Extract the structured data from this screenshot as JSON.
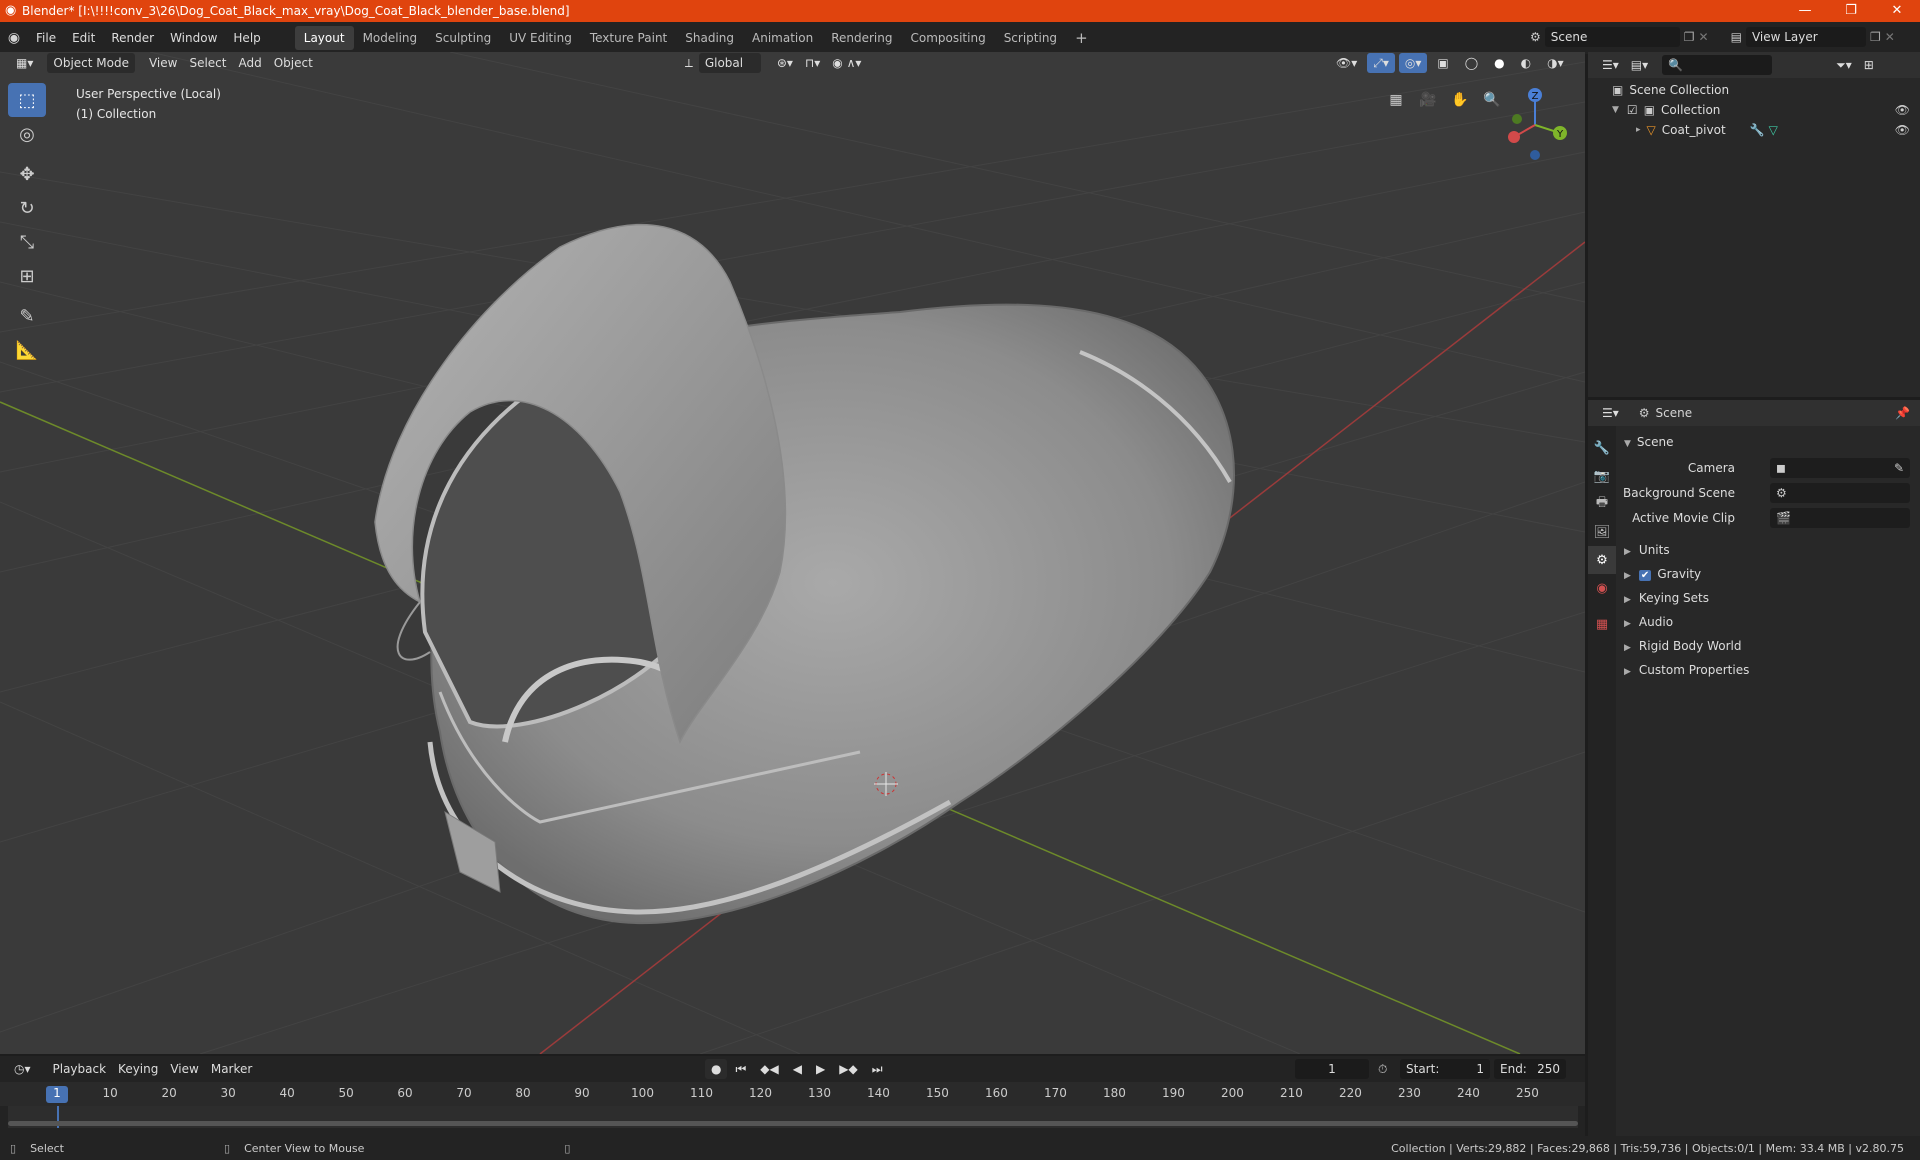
{
  "window": {
    "title": "Blender* [I:\\!!!!conv_3\\26\\Dog_Coat_Black_max_vray\\Dog_Coat_Black_blender_base.blend]",
    "minimize": "—",
    "restore": "❐",
    "close": "✕"
  },
  "menu": [
    "File",
    "Edit",
    "Render",
    "Window",
    "Help"
  ],
  "workspaces": [
    "Layout",
    "Modeling",
    "Sculpting",
    "UV Editing",
    "Texture Paint",
    "Shading",
    "Animation",
    "Rendering",
    "Compositing",
    "Scripting"
  ],
  "active_workspace": "Layout",
  "add_workspace": "+",
  "scene_field": "Scene",
  "view_layer_field": "View Layer",
  "viewport_header": {
    "mode": "Object Mode",
    "items": [
      "View",
      "Select",
      "Add",
      "Object"
    ],
    "transform": "Global"
  },
  "viewport_info": {
    "line1": "User Perspective (Local)",
    "line2": "(1) Collection"
  },
  "gizmo": {
    "z": "Z",
    "y": "Y"
  },
  "outliner": {
    "root": "Scene Collection",
    "collection": "Collection",
    "object": "Coat_pivot"
  },
  "properties": {
    "header": "Scene",
    "panel": "Scene",
    "camera_label": "Camera",
    "background_label": "Background Scene",
    "movieclip_label": "Active Movie Clip",
    "sections": [
      "Units",
      "Gravity",
      "Keying Sets",
      "Audio",
      "Rigid Body World",
      "Custom Properties"
    ]
  },
  "timeline": {
    "menus": [
      "Playback",
      "Keying",
      "View",
      "Marker"
    ],
    "current_frame": "1",
    "start_label": "Start:",
    "start_value": "1",
    "end_label": "End:",
    "end_value": "250",
    "ticks": [
      "1",
      "10",
      "20",
      "30",
      "40",
      "50",
      "60",
      "70",
      "80",
      "90",
      "100",
      "110",
      "120",
      "130",
      "140",
      "150",
      "160",
      "170",
      "180",
      "190",
      "200",
      "210",
      "220",
      "230",
      "240",
      "250"
    ]
  },
  "status": {
    "select": "Select",
    "center": "Center View to Mouse",
    "stats": "Collection | Verts:29,882 | Faces:29,868 | Tris:59,736 | Objects:0/1 | Mem: 33.4 MB | v2.80.75"
  },
  "colors": {
    "accent": "#4772b3",
    "titlebar": "#e0440e"
  }
}
